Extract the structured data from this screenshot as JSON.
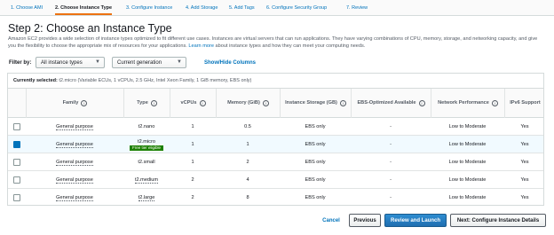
{
  "steps": [
    {
      "label": "1. Choose AMI",
      "active": false
    },
    {
      "label": "2. Choose Instance Type",
      "active": true
    },
    {
      "label": "3. Configure Instance",
      "active": false
    },
    {
      "label": "4. Add Storage",
      "active": false
    },
    {
      "label": "5. Add Tags",
      "active": false
    },
    {
      "label": "6. Configure Security Group",
      "active": false
    },
    {
      "label": "7. Review",
      "active": false
    }
  ],
  "page": {
    "title": "Step 2: Choose an Instance Type",
    "description": "Amazon EC2 provides a wide selection of instance types optimized to fit different use cases. Instances are virtual servers that can run applications. They have varying combinations of CPU, memory, storage, and networking capacity, and give you the flexibility to choose the appropriate mix of resources for your applications.",
    "learn_more": "Learn more",
    "description_tail": "about instance types and how they can meet your computing needs."
  },
  "filter": {
    "label": "Filter by:",
    "instance_types": "All instance types",
    "generation": "Current generation",
    "show_hide": "Show/Hide Columns"
  },
  "current": {
    "label": "Currently selected:",
    "value": "t2.micro (Variable ECUs, 1 vCPUs, 2.5 GHz, Intel Xeon Family, 1 GiB memory, EBS only)"
  },
  "columns": {
    "family": "Family",
    "type": "Type",
    "vcpus": "vCPUs",
    "memory": "Memory (GiB)",
    "storage": "Instance Storage (GB)",
    "ebs": "EBS-Optimized Available",
    "network": "Network Performance",
    "ipv6": "IPv6 Support"
  },
  "rows": [
    {
      "family": "General purpose",
      "type": "t2.nano",
      "badge": "",
      "vcpus": "1",
      "memory": "0.5",
      "storage": "EBS only",
      "ebs": "-",
      "network": "Low to Moderate",
      "ipv6": "Yes",
      "selected": false
    },
    {
      "family": "General purpose",
      "type": "t2.micro",
      "badge": "Free tier eligible",
      "vcpus": "1",
      "memory": "1",
      "storage": "EBS only",
      "ebs": "-",
      "network": "Low to Moderate",
      "ipv6": "Yes",
      "selected": true
    },
    {
      "family": "General purpose",
      "type": "t2.small",
      "badge": "",
      "vcpus": "1",
      "memory": "2",
      "storage": "EBS only",
      "ebs": "-",
      "network": "Low to Moderate",
      "ipv6": "Yes",
      "selected": false
    },
    {
      "family": "General purpose",
      "type": "t2.medium",
      "badge": "",
      "vcpus": "2",
      "memory": "4",
      "storage": "EBS only",
      "ebs": "-",
      "network": "Low to Moderate",
      "ipv6": "Yes",
      "selected": false
    },
    {
      "family": "General purpose",
      "type": "t2.large",
      "badge": "",
      "vcpus": "2",
      "memory": "8",
      "storage": "EBS only",
      "ebs": "-",
      "network": "Low to Moderate",
      "ipv6": "Yes",
      "selected": false
    }
  ],
  "footer": {
    "cancel": "Cancel",
    "previous": "Previous",
    "review_launch": "Review and Launch",
    "next": "Next: Configure Instance Details"
  },
  "colors": {
    "link": "#0073bb",
    "primary_button": "#1f6eb0",
    "free_tier_badge": "#1d8102",
    "active_step_underline": "#ec7211"
  }
}
